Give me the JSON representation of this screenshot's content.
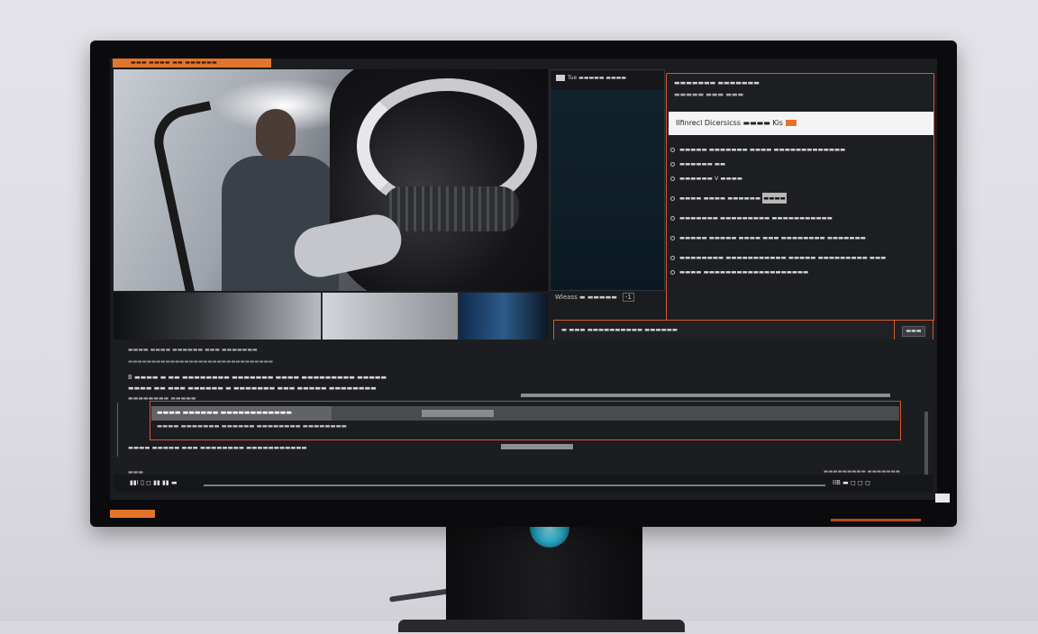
{
  "screen": {
    "top_tab_label": "▬▬▬ ▬▬▬▬ ▬▬ ▬▬▬▬▬▬"
  },
  "media_panel": {
    "header": "Tue ▬▬▬▬▬ ▬▬▬▬",
    "footer_label": "Wleass ▬ ▬▬▬▬▬",
    "footer_timecode": "-1"
  },
  "inspector": {
    "title": "▬▬▬▬▬▬▬ ▬▬▬▬▬▬▬",
    "subtitle": "▬▬▬▬▬ ▬▬▬ ▬▬▬",
    "input_value": "Ilfinrecl Dicersicss ▬▬▬▬ Kis",
    "rows": [
      {
        "text": "▬▬▬▬▬ ▬▬▬▬▬▬▬ ▬▬▬▬ ▬▬▬▬▬▬▬▬▬▬▬▬▬"
      },
      {
        "text": "▬▬▬▬▬▬ ▬▬"
      },
      {
        "text": "▬▬▬▬▬▬ V ▬▬▬▬"
      },
      {
        "text": "▬▬▬▬ ▬▬▬▬ ▬▬▬▬▬▬",
        "highlight": "▬▬▬▬"
      },
      {
        "text": "▬▬▬▬▬▬▬ ▬▬▬▬▬▬▬▬▬ ▬▬▬▬▬▬▬▬▬▬▬"
      },
      {
        "text": "▬▬▬▬▬ ▬▬▬▬▬ ▬▬▬▬ ▬▬▬ ▬▬▬▬▬▬▬▬ ▬▬▬▬▬▬▬"
      },
      {
        "text": "▬▬▬▬▬▬▬▬ ▬▬▬▬▬▬▬▬▬▬▬ ▬▬▬▬▬ ▬▬▬▬▬▬▬▬▬ ▬▬▬"
      },
      {
        "text": "▬▬▬▬ ▬▬▬▬▬▬▬▬▬▬▬▬▬▬▬▬▬▬▬"
      }
    ]
  },
  "dialog": {
    "line1": "▬ ▬▬▬ ▬▬▬▬▬▬▬▬▬▬ ▬▬▬▬▬▬",
    "line2": "▬ ▬▬▬▬ ▬▬▬ ▬▬▬ ▬▬▬▬▬▬▬ ▬▬▬▬▬▬▬▬▬▬▬ ▬▬▬▬▬▬▬▬ ▬▬▬▬▬▬▬▬▬",
    "line3": "▬▬▬▬▬ ▬▬▬▬▬▬▬▬",
    "top_button": "▬▬▬"
  },
  "timeline": {
    "header": "▬▬▬▬ ▬▬▬▬ ▬▬▬▬▬▬ ▬▬▬ ▬▬▬▬▬▬▬",
    "header2": "▬▬▬▬▬▬▬▬▬▬▬▬▬▬▬▬▬▬▬▬▬▬▬▬▬▬▬▬▬▬▬",
    "text1": "B ▬▬▬▬ ▬ ▬▬ ▬▬▬▬▬▬▬▬ ▬▬▬▬▬▬▬ ▬▬▬▬ ▬▬▬▬▬▬▬▬▬ ▬▬▬▬▬",
    "text2": "▬▬▬▬ ▬▬ ▬▬▬ ▬▬▬▬▬▬ ▬ ▬▬▬▬▬▬▬ ▬▬▬ ▬▬▬▬▬ ▬▬▬▬▬▬▬▬",
    "text3": "▬▬▬▬▬▬▬▬ ▬▬▬▬▬",
    "clip_label": "▬▬▬▬ ▬▬▬▬▬▬ ▬▬▬▬▬▬▬▬▬▬▬▬",
    "clip_sub": "▬▬▬▬ ▬▬▬▬▬▬▬ ▬▬▬▬▬▬ ▬▬▬▬▬▬▬▬ ▬▬▬▬▬▬▬▬",
    "under": "▬▬▬▬ ▬▬▬▬▬ ▬▬▬ ▬▬▬▬▬▬▬▬ ▬▬▬▬▬▬▬▬▬▬▬",
    "small": "▬▬▬",
    "right": "▬▬▬▬▬▬▬▬▬  ▬▬▬▬▬▬▬"
  },
  "transport": {
    "left_controls": "▮▮I ▯ ◻ ▮▮ ▮▮ ▬",
    "right_controls": "IIB ▬ ◻ ◻ ◻"
  },
  "colors": {
    "accent": "#e2742c",
    "highlight_border": "#d9592c",
    "panel_bg": "#1d1e21"
  }
}
